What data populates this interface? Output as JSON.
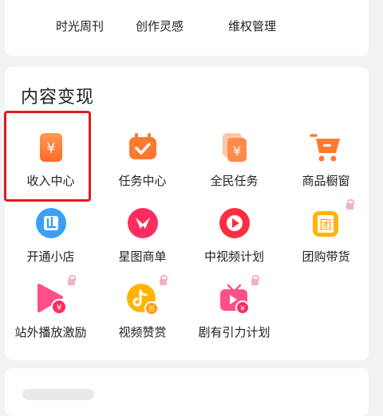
{
  "top_row": [
    {
      "label": "时光周刊",
      "icon": "clock-icon"
    },
    {
      "label": "创作灵感",
      "icon": "bulb-icon"
    },
    {
      "label": "维权管理",
      "icon": "shield-icon"
    }
  ],
  "section": {
    "title": "内容变现",
    "items": [
      {
        "label": "收入中心",
        "icon": "income-yuan-icon"
      },
      {
        "label": "任务中心",
        "icon": "task-calendar-check-icon"
      },
      {
        "label": "全民任务",
        "icon": "all-people-task-yuan-icon"
      },
      {
        "label": "商品橱窗",
        "icon": "shopping-cart-icon"
      },
      {
        "label": "开通小店",
        "icon": "store-icon"
      },
      {
        "label": "星图商单",
        "icon": "star-map-icon"
      },
      {
        "label": "中视频计划",
        "icon": "video-play-icon"
      },
      {
        "label": "团购带货",
        "icon": "group-buy-icon"
      },
      {
        "label": "站外播放激励",
        "icon": "play-yuan-icon"
      },
      {
        "label": "视频赞赏",
        "icon": "tiktok-coin-icon"
      },
      {
        "label": "剧有引力计划",
        "icon": "tv-yuan-icon"
      }
    ]
  },
  "icon_glyphs": {
    "yuan": "¥",
    "tuan": "团",
    "bi": "币"
  },
  "colors": {
    "orange": "#ff7a2e",
    "pink": "#ff3b6b",
    "highlight": "#e01b1b",
    "blue": "#3aa0f5",
    "yellow": "#ffb400"
  }
}
